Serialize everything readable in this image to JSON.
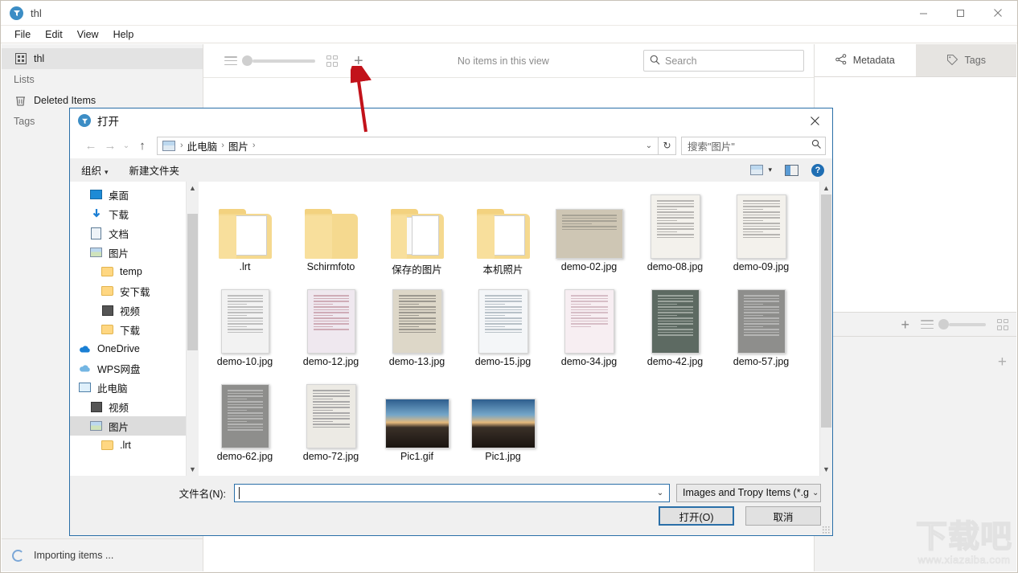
{
  "app": {
    "title": "thl",
    "icon": "tropy-icon",
    "window_controls": {
      "minimize": "—",
      "maximize": "▢",
      "close": "✕"
    },
    "menu": [
      "File",
      "Edit",
      "View",
      "Help"
    ],
    "sidebar": {
      "project": {
        "label": "thl",
        "icon": "project-icon"
      },
      "lists_header": "Lists",
      "deleted_items": {
        "label": "Deleted Items",
        "icon": "trash-icon"
      },
      "tags_header": "Tags"
    },
    "status": {
      "text": "Importing items ...",
      "icon": "spinner-icon"
    },
    "toolbar": {
      "view_status": "No items in this view",
      "search_placeholder": "Search",
      "add_label": "+",
      "list_icon": "list-view-icon",
      "grid_icon": "grid-view-icon",
      "zoom_value": 0
    },
    "right_panel": {
      "tabs": [
        {
          "label": "Metadata",
          "icon": "metadata-icon",
          "active": true
        },
        {
          "label": "Tags",
          "icon": "tag-icon",
          "active": false
        }
      ],
      "add_label": "+",
      "note_add_label": "+"
    },
    "watermark": {
      "big": "下载吧",
      "small": "www.xiazaiba.com"
    }
  },
  "dialog": {
    "title": "打开",
    "close_label": "✕",
    "nav": {
      "back": "←",
      "forward": "→",
      "recent": "⌄",
      "up": "↑",
      "refresh": "↻",
      "address_dropdown": "⌄",
      "breadcrumbs": [
        "此电脑",
        "图片"
      ],
      "search_placeholder": "搜索\"图片\"",
      "search_icon": "search-icon"
    },
    "commandbar": {
      "organize": "组织",
      "organize_caret": "▾",
      "new_folder": "新建文件夹",
      "view_icon": "view-mode-icon",
      "view_caret": "▾",
      "pane_icon": "preview-pane-icon",
      "help_icon": "help-icon",
      "help_label": "?"
    },
    "tree": [
      {
        "label": "桌面",
        "icon": "desktop-icon",
        "pin": true,
        "indent": 1
      },
      {
        "label": "下载",
        "icon": "downloads-icon",
        "pin": true,
        "indent": 1
      },
      {
        "label": "文档",
        "icon": "documents-icon",
        "pin": true,
        "indent": 1
      },
      {
        "label": "图片",
        "icon": "pictures-icon",
        "pin": true,
        "indent": 1
      },
      {
        "label": "temp",
        "icon": "folder-icon",
        "pin": false,
        "indent": 2
      },
      {
        "label": "安下载",
        "icon": "folder-icon",
        "pin": false,
        "indent": 2
      },
      {
        "label": "视频",
        "icon": "video-folder-icon",
        "pin": false,
        "indent": 2
      },
      {
        "label": "下载",
        "icon": "folder-icon",
        "pin": false,
        "indent": 2
      },
      {
        "label": "OneDrive",
        "icon": "onedrive-icon",
        "pin": false,
        "indent": 0
      },
      {
        "label": "WPS网盘",
        "icon": "wps-cloud-icon",
        "pin": false,
        "indent": 0
      },
      {
        "label": "此电脑",
        "icon": "this-pc-icon",
        "pin": false,
        "indent": 0
      },
      {
        "label": "视频",
        "icon": "video-folder-icon",
        "pin": false,
        "indent": 1
      },
      {
        "label": "图片",
        "icon": "pictures-icon",
        "pin": false,
        "indent": 1,
        "selected": true
      },
      {
        "label": ".lrt",
        "icon": "folder-icon",
        "pin": false,
        "indent": 2
      }
    ],
    "files": [
      {
        "name": ".lrt",
        "type": "folder-doc"
      },
      {
        "name": "Schirmfoto",
        "type": "folder"
      },
      {
        "name": "保存的图片",
        "type": "folder-docs"
      },
      {
        "name": "本机照片",
        "type": "folder-doc"
      },
      {
        "name": "demo-02.jpg",
        "type": "photo-landscape"
      },
      {
        "name": "demo-08.jpg",
        "type": "photo-doc-light"
      },
      {
        "name": "demo-09.jpg",
        "type": "photo-doc-light"
      },
      {
        "name": "demo-10.jpg",
        "type": "photo-license"
      },
      {
        "name": "demo-12.jpg",
        "type": "photo-red-doc"
      },
      {
        "name": "demo-13.jpg",
        "type": "photo-doc-tan"
      },
      {
        "name": "demo-15.jpg",
        "type": "photo-form"
      },
      {
        "name": "demo-34.jpg",
        "type": "photo-pink"
      },
      {
        "name": "demo-42.jpg",
        "type": "photo-dark-doc"
      },
      {
        "name": "demo-57.jpg",
        "type": "photo-gray-doc"
      },
      {
        "name": "demo-62.jpg",
        "type": "photo-gray-doc"
      },
      {
        "name": "demo-72.jpg",
        "type": "photo-notes"
      },
      {
        "name": "Pic1.gif",
        "type": "photo-lighthouse"
      },
      {
        "name": "Pic1.jpg",
        "type": "photo-lighthouse"
      }
    ],
    "footer": {
      "filename_label": "文件名(N):",
      "filename_value": "",
      "filename_dropdown": "⌄",
      "filter_label": "Images and Tropy Items (*.g",
      "filter_dropdown": "⌄",
      "open_button": "打开(O)",
      "cancel_button": "取消"
    }
  },
  "annotation": {
    "arrow": "red-up-arrow",
    "points_to": "add-item-button"
  },
  "colors": {
    "accent": "#2a6fa8",
    "app_icon": "#3c8dc5",
    "selection": "#cde8ff",
    "arrow": "#c2121a",
    "sidebar_bg": "#f2f2f2"
  }
}
